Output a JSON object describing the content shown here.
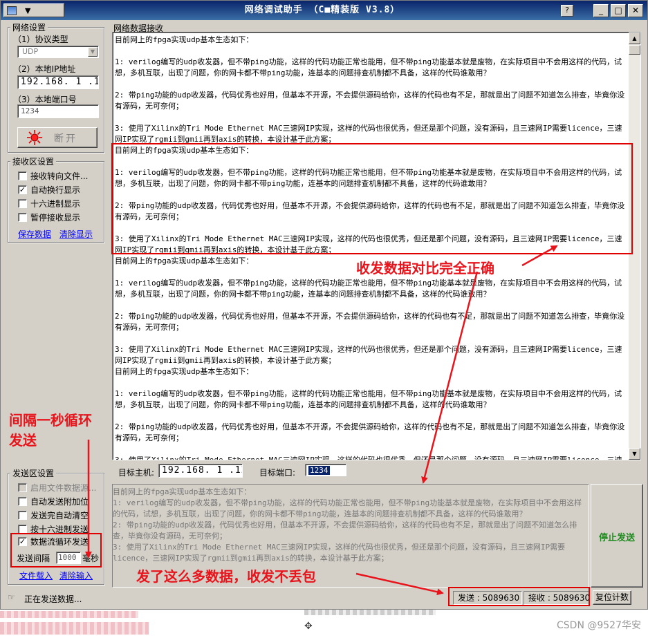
{
  "window": {
    "title": "网络调试助手 （C■精装版 V3.8）",
    "sysmenu_arrow": "▼"
  },
  "net_settings": {
    "title": "网络设置",
    "protocol_label": "（1）协议类型",
    "protocol_value": "UDP",
    "ip_label": "（2）本地IP地址",
    "ip_value": "192.168. 1 .10",
    "port_label": "（3）本地端口号",
    "port_value": "1234",
    "disconnect_label": "断开"
  },
  "recv_settings": {
    "title": "接收区设置",
    "options": [
      {
        "label": "接收转向文件...",
        "checked": false
      },
      {
        "label": "自动换行显示",
        "checked": true
      },
      {
        "label": "十六进制显示",
        "checked": false
      },
      {
        "label": "暂停接收显示",
        "checked": false
      }
    ],
    "save_link": "保存数据",
    "clear_link": "清除显示"
  },
  "send_settings": {
    "title": "发送区设置",
    "options": [
      {
        "label": "启用文件数据源...",
        "checked": false,
        "disabled": true
      },
      {
        "label": "自动发送附加位",
        "checked": false,
        "disabled": false
      },
      {
        "label": "发送完自动清空",
        "checked": false,
        "disabled": false
      },
      {
        "label": "按十六进制发送",
        "checked": false,
        "disabled": false
      },
      {
        "label": "数据流循环发送",
        "checked": true,
        "disabled": false
      }
    ],
    "interval_label": "发送间隔",
    "interval_value": "1000",
    "interval_unit": "毫秒",
    "load_link": "文件载入",
    "clear_link": "清除输入"
  },
  "recv_panel": {
    "title": "网络数据接收",
    "text": "目前网上的fpga实现udp基本生态如下：\n\n1: verilog编写的udp收发器，但不带ping功能，这样的代码功能正常也能用，但不带ping功能基本就是废物，在实际项目中不会用这样的代码，试想，多机互联，出现了问题，你的网卡都不带ping功能，连基本的问题排查机制都不具备，这样的代码谁敢用？\n\n2: 带ping功能的udp收发器，代码优秀也好用，但基本不开源，不会提供源码给你，这样的代码也有不足，那就是出了问题不知道怎么排查，毕竟你没有源码，无可奈何；\n\n3: 使用了Xilinx的Tri Mode Ethernet MAC三速网IP实现，这样的代码也很优秀，但还是那个问题，没有源码，且三速网IP需要licence，三速网IP实现了rgmii到gmii再到axis的转换，本设计基于此方案；\n目前网上的fpga实现udp基本生态如下：\n\n1: verilog编写的udp收发器，但不带ping功能，这样的代码功能正常也能用，但不带ping功能基本就是废物，在实际项目中不会用这样的代码，试想，多机互联，出现了问题，你的网卡都不带ping功能，连基本的问题排查机制都不具备，这样的代码谁敢用？\n\n2: 带ping功能的udp收发器，代码优秀也好用，但基本不开源，不会提供源码给你，这样的代码也有不足，那就是出了问题不知道怎么排查，毕竟你没有源码，无可奈何；\n\n3: 使用了Xilinx的Tri Mode Ethernet MAC三速网IP实现，这样的代码也很优秀，但还是那个问题，没有源码，且三速网IP需要licence，三速网IP实现了rgmii到gmii再到axis的转换，本设计基于此方案；\n目前网上的fpga实现udp基本生态如下：\n\n1: verilog编写的udp收发器，但不带ping功能，这样的代码功能正常也能用，但不带ping功能基本就是废物，在实际项目中不会用这样的代码，试想，多机互联，出现了问题，你的网卡都不带ping功能，连基本的问题排查机制都不具备，这样的代码谁敢用？\n\n2: 带ping功能的udp收发器，代码优秀也好用，但基本不开源，不会提供源码给你，这样的代码也有不足，那就是出了问题不知道怎么排查，毕竟你没有源码，无可奈何；\n\n3: 使用了Xilinx的Tri Mode Ethernet MAC三速网IP实现，这样的代码也很优秀，但还是那个问题，没有源码，且三速网IP需要licence，三速网IP实现了rgmii到gmii再到axis的转换，本设计基于此方案；\n目前网上的fpga实现udp基本生态如下：\n\n1: verilog编写的udp收发器，但不带ping功能，这样的代码功能正常也能用，但不带ping功能基本就是废物，在实际项目中不会用这样的代码，试想，多机互联，出现了问题，你的网卡都不带ping功能，连基本的问题排查机制都不具备，这样的代码谁敢用？\n\n2: 带ping功能的udp收发器，代码优秀也好用，但基本不开源，不会提供源码给你，这样的代码也有不足，那就是出了问题不知道怎么排查，毕竟你没有源码，无可奈何；\n\n3: 使用了Xilinx的Tri Mode Ethernet MAC三速网IP实现，这样的代码也很优秀，但还是那个问题，没有源码，且三速网IP需要licence，三速网IP实现了rgmii到gmii再到axis的转换，本设计基于此方案；"
  },
  "target": {
    "host_label": "目标主机:",
    "host_value": "192.168. 1 .128",
    "port_label": "目标端口:",
    "port_value": "1234"
  },
  "send_panel": {
    "text": "目前网上的fpga实现udp基本生态如下：\n1: verilog编写的udp收发器，但不带ping功能，这样的代码功能正常也能用，但不带ping功能基本就是废物，在实际项目中不会用这样的代码，试想，多机互联，出现了问题，你的网卡都不带ping功能，连基本的问题排查机制都不具备，这样的代码谁敢用？\n2: 带ping功能的udp收发器，代码优秀也好用，但基本不开源，不会提供源码给你，这样的代码也有不足，那就是出了问题不知道怎么排查，毕竟你没有源码，无可奈何；\n3: 使用了Xilinx的Tri Mode Ethernet MAC三速网IP实现，这样的代码也很优秀，但还是那个问题，没有源码，且三速网IP需要licence，三速网IP实现了rgmii到gmii再到axis的转换，本设计基于此方案；",
    "stop_button": "停止发送"
  },
  "status": {
    "state_text": "正在发送数据...",
    "send_label": "发送 : 5089630",
    "recv_label": "接收 : 5089630",
    "reset_button": "复位计数"
  },
  "annotations": {
    "correct": "收发数据对比完全正确",
    "loop": "间隔一秒循环\n发送",
    "no_loss": "发了这么多数据，收发不丢包"
  },
  "watermark": "CSDN @9527华安",
  "colors": {
    "annotation_red": "#e8141c",
    "stop_green": "#1f8b1f",
    "titlebar_start": "#0a246a",
    "titlebar_end": "#3a6ea5"
  }
}
